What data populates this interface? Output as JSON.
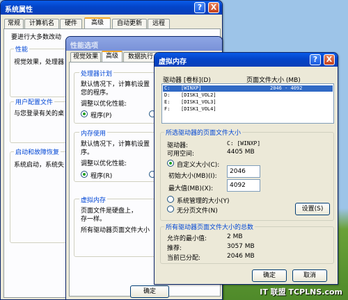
{
  "system_properties": {
    "title": "系统属性",
    "tabs": [
      "常规",
      "计算机名",
      "硬件",
      "高级",
      "自动更新",
      "远程"
    ],
    "intro_text": "要进行大多数改动",
    "performance_title": "性能",
    "performance_text": "视觉效果，处理器",
    "user_profile_title": "用户配置文件",
    "user_profile_text": "与您登录有关的桌",
    "startup_title": "启动和故障恢复",
    "startup_text": "系统启动，系统失",
    "help_btn": "?",
    "close_btn": "X"
  },
  "performance_options": {
    "title": "性能选项",
    "tabs": [
      "视觉效果",
      "高级",
      "数据执行"
    ],
    "processor_title": "处理器计划",
    "processor_text1": "默认情况下，计算机设置",
    "processor_text2": "您的程序。",
    "processor_adjust": "调整以优化性能:",
    "processor_radio": "程序(P)",
    "memory_title": "内存使用",
    "memory_text1": "默认情况下，计算机设置",
    "memory_text2": "序。",
    "memory_adjust": "调整以优化性能:",
    "memory_radio": "程序(R)",
    "vm_title": "虚拟内存",
    "vm_text1": "页面文件是硬盘上，",
    "vm_text2": "存一样。",
    "vm_text3": "所有驱动器页面文件大小",
    "ok_btn": "确定",
    "help_btn": "?",
    "close_btn": "X"
  },
  "virtual_memory": {
    "title": "虚拟内存",
    "col_drive": "驱动器 [卷标](D)",
    "col_size": "页面文件大小 (MB)",
    "drives": [
      {
        "drive": "C:",
        "label": "[WINXP]",
        "size": "2046 - 4092"
      },
      {
        "drive": "D:",
        "label": "[DISK1_VOL2]",
        "size": ""
      },
      {
        "drive": "E:",
        "label": "[DISK1_VOL3]",
        "size": ""
      },
      {
        "drive": "F:",
        "label": "[DISK1_VOL4]",
        "size": ""
      }
    ],
    "selected_group_title": "所选驱动器的页面文件大小",
    "drive_label": "驱动器:",
    "drive_value": "C:  [WINXP]",
    "free_label": "可用空间:",
    "free_value": "4405 MB",
    "custom_label": "自定义大小(C):",
    "initial_label": "初始大小(MB)(I):",
    "initial_value": "2046",
    "max_label": "最大值(MB)(X):",
    "max_value": "4092",
    "system_managed_label": "系统管理的大小(Y)",
    "no_paging_label": "无分页文件(N)",
    "set_btn": "设置(S)",
    "total_group_title": "所有驱动器页面文件大小的总数",
    "min_allowed_label": "允许的最小值:",
    "min_allowed_value": "2 MB",
    "recommended_label": "推荐:",
    "recommended_value": "3057 MB",
    "allocated_label": "当前已分配:",
    "allocated_value": "2046 MB",
    "ok_btn": "确定",
    "cancel_btn": "取消",
    "help_btn": "?",
    "close_btn": "X"
  },
  "watermark": "IT 联盟 TCPLNS.com"
}
